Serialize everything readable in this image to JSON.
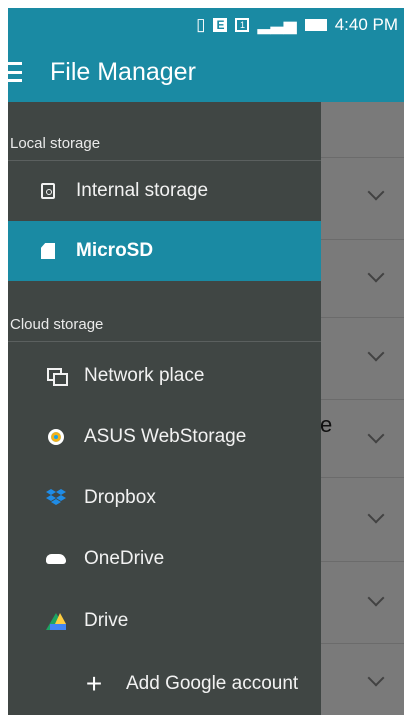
{
  "status_bar": {
    "time": "4:40 PM",
    "icons": [
      "vibrate-icon",
      "edge-data-icon",
      "sim-icon",
      "signal-icon",
      "battery-icon"
    ]
  },
  "app_bar": {
    "title": "File Manager",
    "menu_icon": "hamburger-menu-icon"
  },
  "drawer": {
    "local_header": "Local storage",
    "local_items": [
      {
        "label": "Internal storage",
        "icon": "internal-storage-icon",
        "selected": false
      },
      {
        "label": "MicroSD",
        "icon": "sd-card-icon",
        "selected": true
      }
    ],
    "cloud_header": "Cloud storage",
    "cloud_items": [
      {
        "label": "Network place",
        "icon": "network-place-icon"
      },
      {
        "label": "ASUS WebStorage",
        "icon": "asus-webstorage-icon"
      },
      {
        "label": "Dropbox",
        "icon": "dropbox-icon"
      },
      {
        "label": "OneDrive",
        "icon": "onedrive-icon"
      },
      {
        "label": "Drive",
        "icon": "google-drive-icon"
      }
    ],
    "add_account": {
      "label": "Add Google account",
      "icon": "plus-icon"
    }
  },
  "background": {
    "partial_text": "e",
    "chevron_icon": "chevron-down-icon"
  },
  "colors": {
    "accent": "#1a8aa3",
    "drawer_bg": "#404644",
    "drawer_text": "#f2f2f2"
  }
}
